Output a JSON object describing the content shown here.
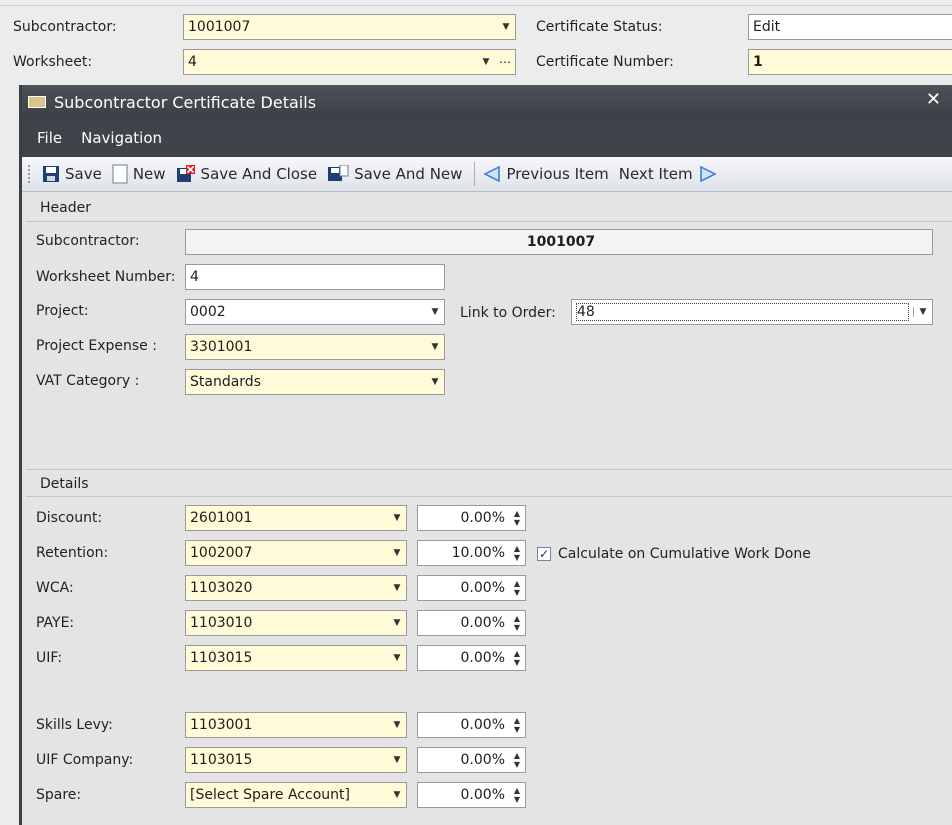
{
  "background": {
    "subcontractor_label": "Subcontractor:",
    "subcontractor_value": "1001007",
    "worksheet_label": "Worksheet:",
    "worksheet_value": "4",
    "certificate_status_label": "Certificate Status:",
    "certificate_status_value": "Edit",
    "certificate_number_label": "Certificate Number:",
    "certificate_number_value": "1"
  },
  "dialog": {
    "title": "Subcontractor Certificate Details",
    "menu": [
      "File",
      "Navigation"
    ],
    "toolbar": {
      "save": "Save",
      "new": "New",
      "save_and_close": "Save And Close",
      "save_and_new": "Save And New",
      "previous_item": "Previous Item",
      "next_item": "Next Item"
    },
    "header": {
      "section_label": "Header",
      "subcontractor_label": "Subcontractor:",
      "subcontractor_value": "1001007",
      "worksheet_number_label": "Worksheet Number:",
      "worksheet_number_value": "4",
      "project_label": "Project:",
      "project_value": "0002",
      "link_to_order_label": "Link to Order:",
      "link_to_order_value": "48",
      "project_expense_label": "Project Expense :",
      "project_expense_value": "3301001",
      "vat_category_label": "VAT Category :",
      "vat_category_value": "Standards"
    },
    "details": {
      "section_label": "Details",
      "calculate_label": "Calculate on Cumulative Work Done",
      "calculate_checked": true,
      "rows": [
        {
          "label": "Discount:",
          "account": "2601001",
          "percent": "0.00%"
        },
        {
          "label": "Retention:",
          "account": "1002007",
          "percent": "10.00%"
        },
        {
          "label": "WCA:",
          "account": "1103020",
          "percent": "0.00%"
        },
        {
          "label": "PAYE:",
          "account": "1103010",
          "percent": "0.00%"
        },
        {
          "label": "UIF:",
          "account": "1103015",
          "percent": "0.00%"
        },
        {
          "label": "Skills Levy:",
          "account": "1103001",
          "percent": "0.00%"
        },
        {
          "label": "UIF Company:",
          "account": "1103015",
          "percent": "0.00%"
        },
        {
          "label": "Spare:",
          "account": "[Select Spare Account]",
          "percent": "0.00%"
        }
      ]
    }
  },
  "colors": {
    "titlebar": "#3b3f46",
    "field_yellow": "#fffbd8",
    "toolbar_accent": "#3b78d8"
  }
}
